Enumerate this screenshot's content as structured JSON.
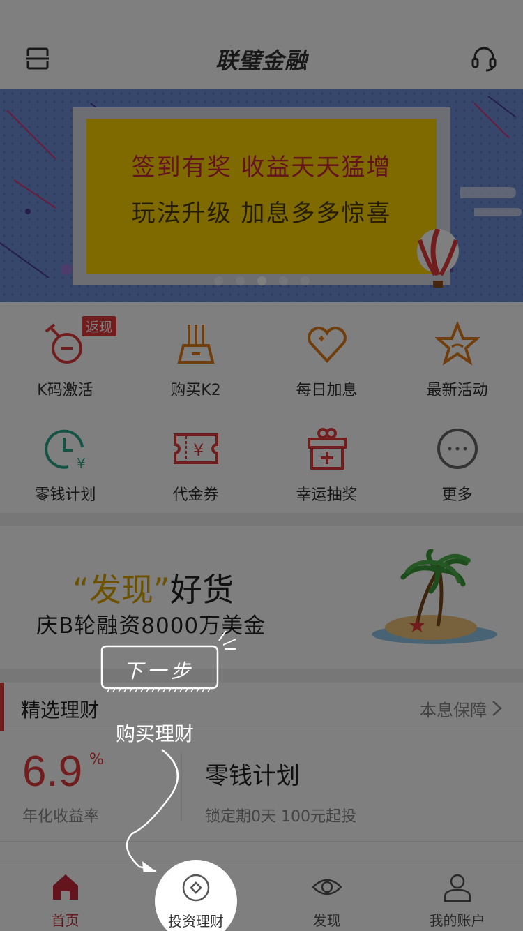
{
  "header": {
    "title": "联璧金融",
    "left_icon": "scan-icon",
    "right_icon": "headset-icon"
  },
  "banner": {
    "line1": "签到有奖 收益天天猛增",
    "line2": "玩法升级 加息多多惊喜",
    "page_count": 5,
    "active_page": 3
  },
  "grid": {
    "items": [
      {
        "label": "K码激活",
        "icon": "stopwatch-icon",
        "color": "#e23b3b",
        "badge": "返现"
      },
      {
        "label": "购买K2",
        "icon": "router-icon",
        "color": "#e07b1a"
      },
      {
        "label": "每日加息",
        "icon": "heart-plus-icon",
        "color": "#e07b1a"
      },
      {
        "label": "最新活动",
        "icon": "star-icon",
        "color": "#e07b1a"
      },
      {
        "label": "零钱计划",
        "icon": "clock-yuan-icon",
        "color": "#2aa889"
      },
      {
        "label": "代金券",
        "icon": "coupon-icon",
        "color": "#e23b3b"
      },
      {
        "label": "幸运抽奖",
        "icon": "gift-icon",
        "color": "#e23b3b"
      },
      {
        "label": "更多",
        "icon": "more-icon",
        "color": "#666666"
      }
    ]
  },
  "discover": {
    "quote_open": "“",
    "highlight": "发现",
    "quote_close": "”",
    "rest": "好货",
    "subtitle": "庆B轮融资8000万美金"
  },
  "featured": {
    "title": "精选理财",
    "more": "本息保障"
  },
  "product": {
    "rate": "6.9",
    "pct": "%",
    "rate_label": "年化收益率",
    "name": "零钱计划",
    "meta": "锁定期0天  100元起投"
  },
  "tabs": [
    {
      "label": "首页",
      "icon": "home-icon",
      "active": true
    },
    {
      "label": "投资理财",
      "icon": "invest-icon",
      "active": false
    },
    {
      "label": "发现",
      "icon": "eye-icon",
      "active": false
    },
    {
      "label": "我的账户",
      "icon": "account-icon",
      "active": false
    }
  ],
  "guide": {
    "next": "下一步",
    "hint": "购买理财"
  },
  "colors": {
    "accent": "#e23b3b",
    "banner_bg": "#6f8fd6",
    "card": "#ffd400"
  }
}
